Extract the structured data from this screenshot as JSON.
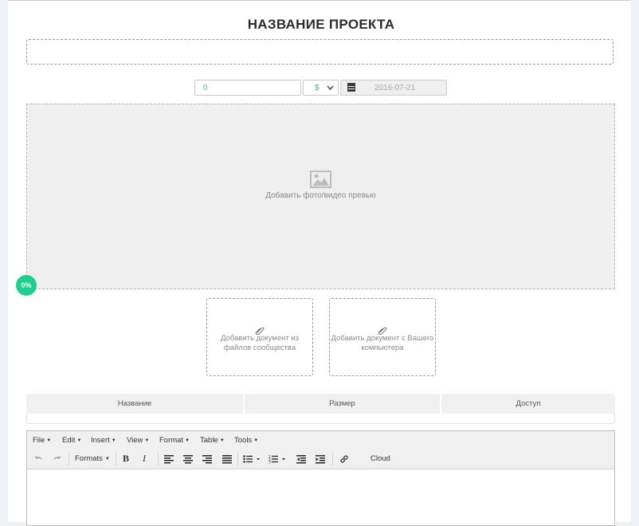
{
  "project": {
    "title": "НАЗВАНИЕ ПРОЕКТА",
    "name_value": "",
    "price_value": "0",
    "currency": "$",
    "date": "2016-07-21",
    "preview_label": "Добавить фото/видео превью",
    "progress": "0%"
  },
  "documents": {
    "from_community": "Добавить документ из файлов сообщества",
    "from_computer": "Добавить документ с Вашего компьютера"
  },
  "files_table": {
    "columns": [
      "Название",
      "Размер",
      "Доступ"
    ]
  },
  "editor": {
    "menu": [
      "File",
      "Edit",
      "Insert",
      "View",
      "Format",
      "Table",
      "Tools"
    ],
    "formats_label": "Formats",
    "cloud_label": "Cloud"
  },
  "colors": {
    "accent_green": "#1fcf8f",
    "value_green": "#55b870"
  }
}
